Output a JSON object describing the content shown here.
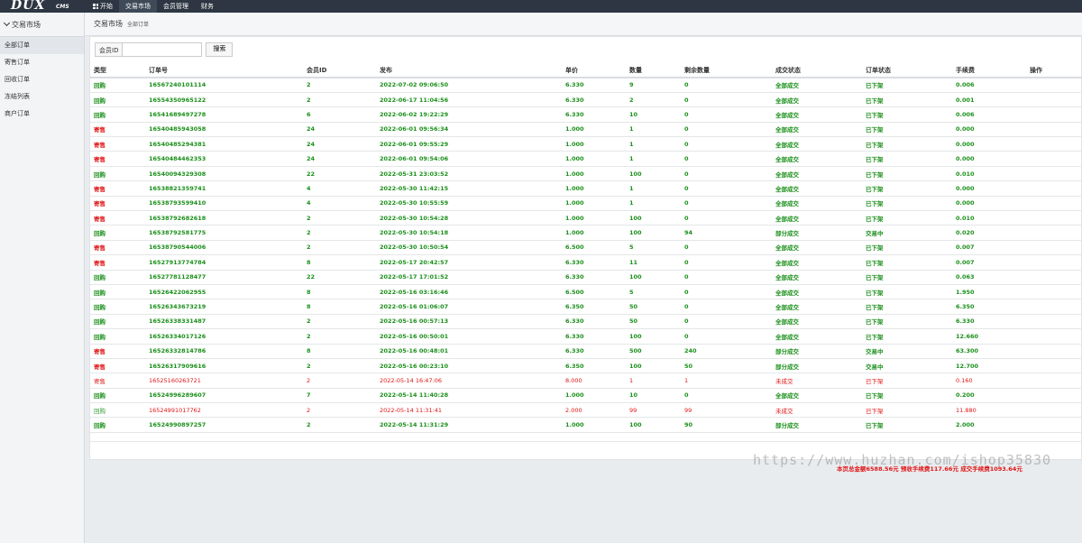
{
  "logo": {
    "main": "DUX",
    "sub": "CMS"
  },
  "nav": [
    "开始",
    "交易市场",
    "会员管理",
    "财务"
  ],
  "sidebar": {
    "title": "交易市场",
    "items": [
      "全部订单",
      "寄售订单",
      "回收订单",
      "冻结列表",
      "商户订单"
    ]
  },
  "breadcrumb": {
    "title": "交易市场",
    "sub": "全部订单"
  },
  "search": {
    "label": "会员ID",
    "placeholder": "",
    "button": "搜索"
  },
  "table": {
    "headers": [
      "类型",
      "订单号",
      "会员ID",
      "发布",
      "单价",
      "数量",
      "剩余数量",
      "成交状态",
      "订单状态",
      "手续费",
      "操作"
    ],
    "rows": [
      {
        "kind": "g",
        "cells": [
          "回购",
          "16567240101114",
          "2",
          "2022-07-02 09:06:50",
          "6.330",
          "9",
          "0",
          "全部成交",
          "已下架",
          "0.006",
          ""
        ]
      },
      {
        "kind": "g",
        "cells": [
          "回购",
          "16554350965122",
          "2",
          "2022-06-17 11:04:56",
          "6.330",
          "2",
          "0",
          "全部成交",
          "已下架",
          "0.001",
          ""
        ]
      },
      {
        "kind": "g",
        "cells": [
          "回购",
          "16541689497278",
          "6",
          "2022-06-02 19:22:29",
          "6.330",
          "10",
          "0",
          "全部成交",
          "已下架",
          "0.006",
          ""
        ]
      },
      {
        "kind": "s",
        "cells": [
          "寄售",
          "16540485943058",
          "24",
          "2022-06-01 09:56:34",
          "1.000",
          "1",
          "0",
          "全部成交",
          "已下架",
          "0.000",
          ""
        ]
      },
      {
        "kind": "s",
        "cells": [
          "寄售",
          "16540485294381",
          "24",
          "2022-06-01 09:55:29",
          "1.000",
          "1",
          "0",
          "全部成交",
          "已下架",
          "0.000",
          ""
        ]
      },
      {
        "kind": "s",
        "cells": [
          "寄售",
          "16540484462353",
          "24",
          "2022-06-01 09:54:06",
          "1.000",
          "1",
          "0",
          "全部成交",
          "已下架",
          "0.000",
          ""
        ]
      },
      {
        "kind": "g",
        "cells": [
          "回购",
          "16540094329308",
          "22",
          "2022-05-31 23:03:52",
          "1.000",
          "100",
          "0",
          "全部成交",
          "已下架",
          "0.010",
          ""
        ]
      },
      {
        "kind": "s",
        "cells": [
          "寄售",
          "16538821359741",
          "4",
          "2022-05-30 11:42:15",
          "1.000",
          "1",
          "0",
          "全部成交",
          "已下架",
          "0.000",
          ""
        ]
      },
      {
        "kind": "s",
        "cells": [
          "寄售",
          "16538793599410",
          "4",
          "2022-05-30 10:55:59",
          "1.000",
          "1",
          "0",
          "全部成交",
          "已下架",
          "0.000",
          ""
        ]
      },
      {
        "kind": "s",
        "cells": [
          "寄售",
          "16538792682618",
          "2",
          "2022-05-30 10:54:28",
          "1.000",
          "100",
          "0",
          "全部成交",
          "已下架",
          "0.010",
          ""
        ]
      },
      {
        "kind": "g",
        "cells": [
          "回购",
          "16538792581775",
          "2",
          "2022-05-30 10:54:18",
          "1.000",
          "100",
          "94",
          "部分成交",
          "交易中",
          "0.020",
          ""
        ]
      },
      {
        "kind": "s",
        "cells": [
          "寄售",
          "16538790544006",
          "2",
          "2022-05-30 10:50:54",
          "6.500",
          "5",
          "0",
          "全部成交",
          "已下架",
          "0.007",
          ""
        ]
      },
      {
        "kind": "s",
        "cells": [
          "寄售",
          "16527913774784",
          "8",
          "2022-05-17 20:42:57",
          "6.330",
          "11",
          "0",
          "全部成交",
          "已下架",
          "0.007",
          ""
        ]
      },
      {
        "kind": "g",
        "cells": [
          "回购",
          "16527781128477",
          "22",
          "2022-05-17 17:01:52",
          "6.330",
          "100",
          "0",
          "全部成交",
          "已下架",
          "0.063",
          ""
        ]
      },
      {
        "kind": "g",
        "cells": [
          "回购",
          "16526422062955",
          "8",
          "2022-05-16 03:16:46",
          "6.500",
          "5",
          "0",
          "全部成交",
          "已下架",
          "1.950",
          ""
        ]
      },
      {
        "kind": "g",
        "cells": [
          "回购",
          "16526343673219",
          "8",
          "2022-05-16 01:06:07",
          "6.350",
          "50",
          "0",
          "全部成交",
          "已下架",
          "6.350",
          ""
        ]
      },
      {
        "kind": "g",
        "cells": [
          "回购",
          "16526338331487",
          "2",
          "2022-05-16 00:57:13",
          "6.330",
          "50",
          "0",
          "全部成交",
          "已下架",
          "6.330",
          ""
        ]
      },
      {
        "kind": "g",
        "cells": [
          "回购",
          "16526334017126",
          "2",
          "2022-05-16 00:50:01",
          "6.330",
          "100",
          "0",
          "全部成交",
          "已下架",
          "12.660",
          ""
        ]
      },
      {
        "kind": "s",
        "cells": [
          "寄售",
          "16526332814786",
          "8",
          "2022-05-16 00:48:01",
          "6.330",
          "500",
          "240",
          "部分成交",
          "交易中",
          "63.300",
          ""
        ]
      },
      {
        "kind": "s",
        "cells": [
          "寄售",
          "16526317909616",
          "2",
          "2022-05-16 00:23:10",
          "6.350",
          "100",
          "50",
          "部分成交",
          "交易中",
          "12.700",
          ""
        ]
      },
      {
        "kind": "r",
        "cells": [
          "寄售",
          "16525160263721",
          "2",
          "2022-05-14 16:47:06",
          "8.000",
          "1",
          "1",
          "未成交",
          "已下架",
          "0.160",
          ""
        ]
      },
      {
        "kind": "g",
        "cells": [
          "回购",
          "16524996289607",
          "7",
          "2022-05-14 11:40:28",
          "1.000",
          "10",
          "0",
          "全部成交",
          "已下架",
          "0.200",
          ""
        ]
      },
      {
        "kind": "rg",
        "cells": [
          "回购",
          "16524991017762",
          "2",
          "2022-05-14 11:31:41",
          "2.000",
          "99",
          "99",
          "未成交",
          "已下架",
          "11.880",
          ""
        ]
      },
      {
        "kind": "g",
        "cells": [
          "回购",
          "16524990897257",
          "2",
          "2022-05-14 11:31:29",
          "1.000",
          "100",
          "90",
          "部分成交",
          "已下架",
          "2.000",
          ""
        ]
      }
    ]
  },
  "summary": "本页总金额6588.56元 预收手续费117.66元 成交手续费1093.64元",
  "watermark": "https://www.huzhan.com/ishop35830"
}
